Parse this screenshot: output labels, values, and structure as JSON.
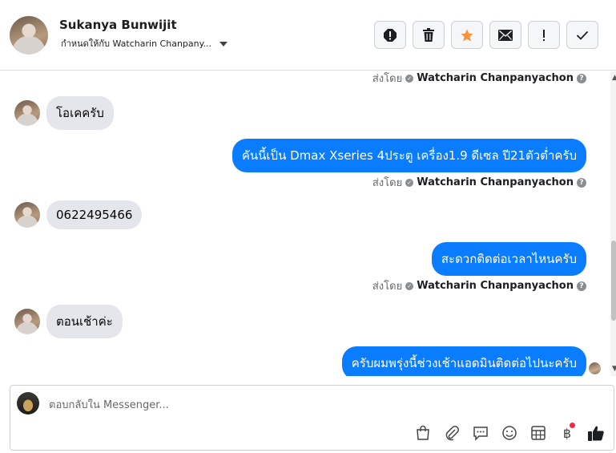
{
  "header": {
    "name": "Sukanya Bunwijit",
    "assigned_label": "กำหนดให้กับ Watcharin Chanpany..."
  },
  "chat": {
    "sent_by_prefix": "ส่งโดย",
    "sent_by_name": "Watcharin Chanpanyachon",
    "messages": [
      {
        "dir": "in",
        "text": "โอเคครับ"
      },
      {
        "dir": "out",
        "text": "คันนี้เป็น Dmax Xseries 4ประตู เครื่อง1.9 ดีเซล ปี21ตัวต่ำครับ"
      },
      {
        "dir": "in",
        "text": "0622495466"
      },
      {
        "dir": "out",
        "text": "สะดวกติดต่อเวลาไหนครับ"
      },
      {
        "dir": "in",
        "text": "ตอนเช้าค่ะ"
      },
      {
        "dir": "out",
        "text": "ครับผมพรุ่งนี้ช่วงเช้าแอดมินติดต่อไปนะครับ"
      }
    ]
  },
  "composer": {
    "placeholder": "ตอบกลับใน Messenger...",
    "baht_symbol": "฿"
  },
  "colors": {
    "outgoing_bubble": "#0a7cff",
    "incoming_bubble": "#e4e6eb",
    "star": "#f7923b",
    "notification_dot": "#f02849"
  }
}
